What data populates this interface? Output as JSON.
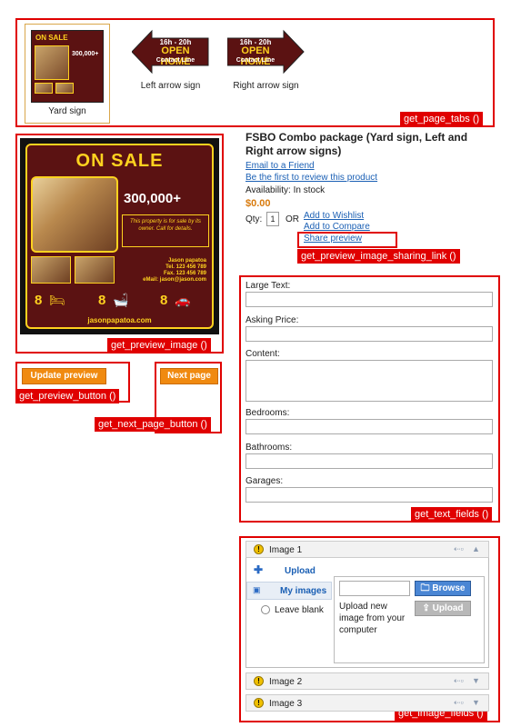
{
  "tabs": [
    {
      "label": "Yard sign"
    },
    {
      "label": "Left arrow sign"
    },
    {
      "label": "Right arrow sign"
    }
  ],
  "sign": {
    "headline": "ON SALE",
    "price_small": "300,000+",
    "price": "300,000+",
    "description": "This property is for sale by its owner. Call for details.",
    "agent_name": "Jason papatoa",
    "agent_tel": "Tel. 123 456 789",
    "agent_fax": "Fax. 123 456 789",
    "agent_email": "eMail: jason@jason.com",
    "bedrooms": "8",
    "bathrooms": "8",
    "garages": "8",
    "website": "jasonpapatoa.com"
  },
  "arrow_sign": {
    "hours": "16h - 20h",
    "headline": "OPEN HOME",
    "subline": "Contact Line"
  },
  "annotations": {
    "page_tabs": "get_page_tabs ()",
    "preview_image": "get_preview_image ()",
    "preview_button": "get_preview_button ()",
    "next_page_button": "get_next_page_button ()",
    "sharing_link": "get_preview_image_sharing_link ()",
    "text_fields": "get_text_fields ()",
    "image_fields": "get_image_fields ()"
  },
  "buttons": {
    "update_preview": "Update preview",
    "next_page": "Next page"
  },
  "product": {
    "title": "FSBO Combo package (Yard sign, Left and Right arrow signs)",
    "email_friend": "Email to a Friend",
    "review": "Be the first to review this product",
    "availability": "Availability: In stock",
    "price": "$0.00",
    "qty_label": "Qty:",
    "qty_value": "1",
    "or": "OR",
    "wishlist": "Add to Wishlist",
    "compare": "Add to Compare",
    "share": "Share preview"
  },
  "text_fields": [
    {
      "label": "Large Text:",
      "value": ""
    },
    {
      "label": "Asking Price:",
      "value": ""
    },
    {
      "label": "Content:",
      "value": ""
    },
    {
      "label": "Bedrooms:",
      "value": ""
    },
    {
      "label": "Bathrooms:",
      "value": ""
    },
    {
      "label": "Garages:",
      "value": ""
    }
  ],
  "image_fields": {
    "image1": "Image 1",
    "upload_tab": "Upload",
    "my_images_tab": "My images",
    "leave_blank": "Leave blank",
    "browse": "Browse",
    "upload_btn": "Upload",
    "upload_help": "Upload new image from your computer",
    "image2": "Image 2",
    "image3": "Image 3"
  }
}
